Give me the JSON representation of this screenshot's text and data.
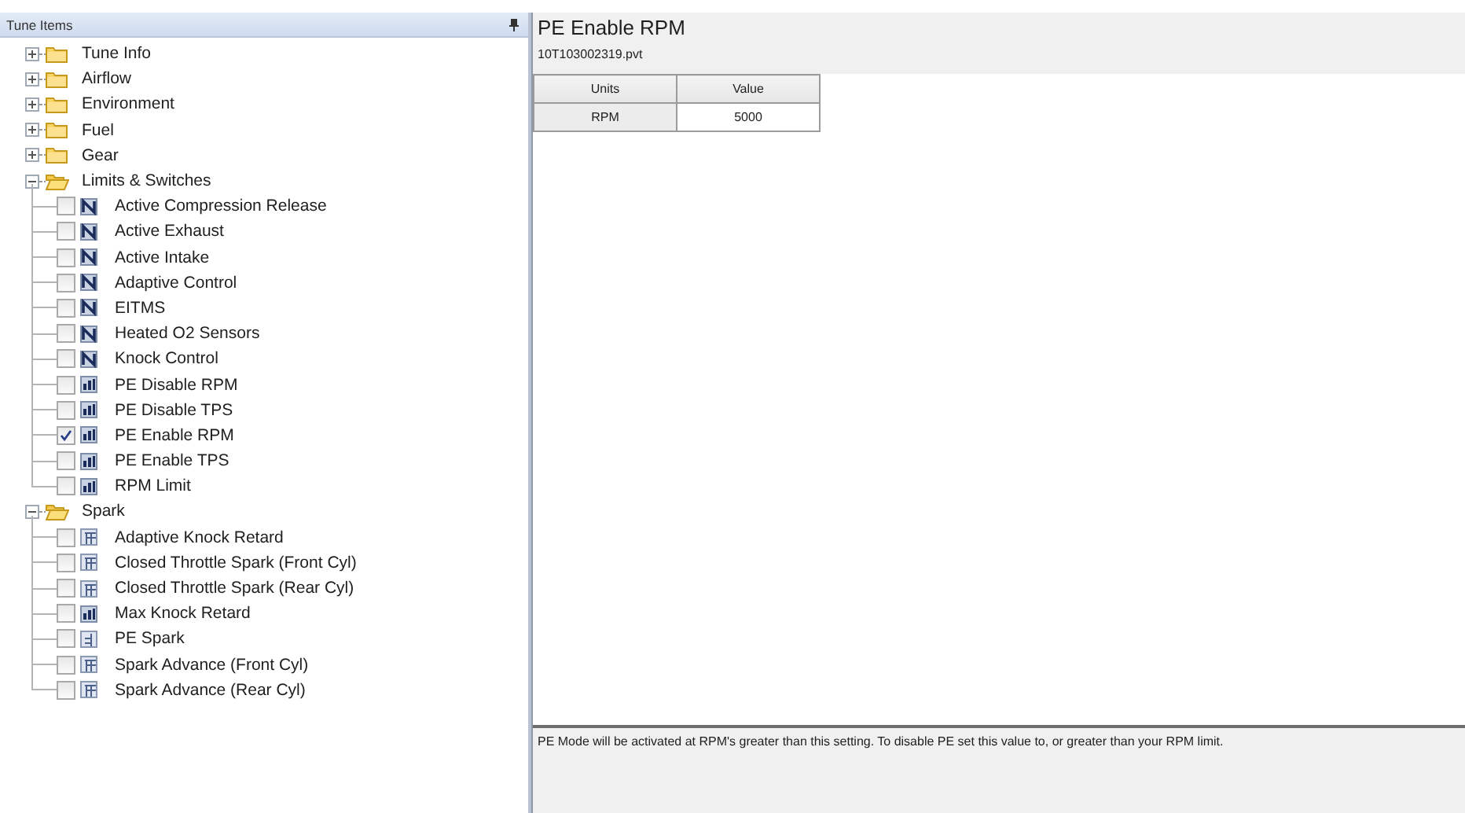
{
  "tree": {
    "title": "Tune Items",
    "nodes": [
      {
        "label": "Tune Info",
        "expanded": false
      },
      {
        "label": "Airflow",
        "expanded": false
      },
      {
        "label": "Environment",
        "expanded": false
      },
      {
        "label": "Fuel",
        "expanded": false
      },
      {
        "label": "Gear",
        "expanded": false
      },
      {
        "label": "Limits & Switches",
        "expanded": true,
        "children": [
          {
            "label": "Active Compression Release",
            "kind": "switch",
            "checked": false
          },
          {
            "label": "Active Exhaust",
            "kind": "switch",
            "checked": false
          },
          {
            "label": "Active Intake",
            "kind": "switch",
            "checked": false
          },
          {
            "label": "Adaptive Control",
            "kind": "switch",
            "checked": false
          },
          {
            "label": "EITMS",
            "kind": "switch",
            "checked": false
          },
          {
            "label": "Heated O2 Sensors",
            "kind": "switch",
            "checked": false
          },
          {
            "label": "Knock Control",
            "kind": "switch",
            "checked": false
          },
          {
            "label": "PE Disable RPM",
            "kind": "value",
            "checked": false
          },
          {
            "label": "PE Disable TPS",
            "kind": "value",
            "checked": false
          },
          {
            "label": "PE Enable RPM",
            "kind": "value",
            "checked": true
          },
          {
            "label": "PE Enable TPS",
            "kind": "value",
            "checked": false
          },
          {
            "label": "RPM Limit",
            "kind": "value",
            "checked": false
          }
        ]
      },
      {
        "label": "Spark",
        "expanded": true,
        "children": [
          {
            "label": "Adaptive Knock Retard",
            "kind": "table",
            "checked": false
          },
          {
            "label": "Closed Throttle Spark (Front Cyl)",
            "kind": "table",
            "checked": false
          },
          {
            "label": "Closed Throttle Spark (Rear Cyl)",
            "kind": "table",
            "checked": false
          },
          {
            "label": "Max Knock Retard",
            "kind": "value",
            "checked": false
          },
          {
            "label": "PE Spark",
            "kind": "list",
            "checked": false
          },
          {
            "label": "Spark Advance (Front Cyl)",
            "kind": "table",
            "checked": false
          },
          {
            "label": "Spark Advance (Rear Cyl)",
            "kind": "table",
            "checked": false
          }
        ]
      }
    ]
  },
  "editor": {
    "title": "PE Enable RPM",
    "file": "10T103002319.pvt",
    "table": {
      "columns": [
        "Units",
        "Value"
      ],
      "rows": [
        [
          "RPM",
          "5000"
        ]
      ]
    },
    "description": "PE Mode will be activated at RPM's greater than this setting. To disable PE set this value to, or greater than your RPM limit."
  }
}
